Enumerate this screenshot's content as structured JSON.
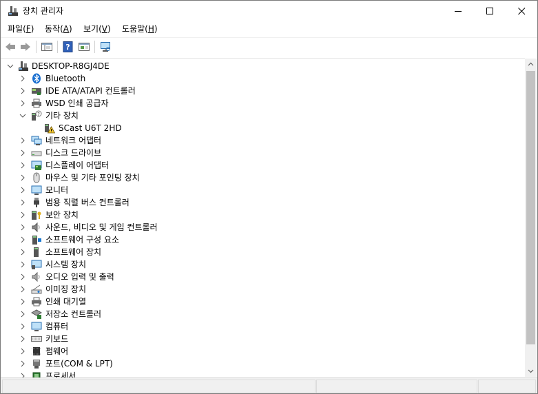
{
  "window": {
    "title": "장치 관리자",
    "buttons": {
      "minimize": "minimize",
      "maximize": "maximize",
      "close": "close"
    }
  },
  "menu": [
    {
      "label": "파일",
      "accel": "F"
    },
    {
      "label": "동작",
      "accel": "A"
    },
    {
      "label": "보기",
      "accel": "V"
    },
    {
      "label": "도움말",
      "accel": "H"
    }
  ],
  "toolbar": {
    "icons": [
      "back-arrow-icon",
      "forward-arrow-icon",
      "properties-pane-icon",
      "help-icon",
      "details-view-icon",
      "monitor-scan-icon"
    ]
  },
  "tree": {
    "root": "DESKTOP-R8GJ4DE",
    "items": [
      {
        "label": "Bluetooth",
        "icon": "bluetooth-icon",
        "expanded": false
      },
      {
        "label": "IDE ATA/ATAPI 컨트롤러",
        "icon": "ide-controller-icon",
        "expanded": false
      },
      {
        "label": "WSD 인쇄 공급자",
        "icon": "printer-icon",
        "expanded": false
      },
      {
        "label": "기타 장치",
        "icon": "unknown-device-icon",
        "expanded": true,
        "children": [
          {
            "label": "SCast U6T 2HD",
            "icon": "warning-device-icon"
          }
        ]
      },
      {
        "label": "네트워크 어댑터",
        "icon": "network-icon",
        "expanded": false
      },
      {
        "label": "디스크 드라이브",
        "icon": "disk-drive-icon",
        "expanded": false
      },
      {
        "label": "디스플레이 어댑터",
        "icon": "display-adapter-icon",
        "expanded": false
      },
      {
        "label": "마우스 및 기타 포인팅 장치",
        "icon": "mouse-icon",
        "expanded": false
      },
      {
        "label": "모니터",
        "icon": "monitor-icon",
        "expanded": false
      },
      {
        "label": "범용 직렬 버스 컨트롤러",
        "icon": "usb-icon",
        "expanded": false
      },
      {
        "label": "보안 장치",
        "icon": "security-device-icon",
        "expanded": false
      },
      {
        "label": "사운드, 비디오 및 게임 컨트롤러",
        "icon": "sound-icon",
        "expanded": false
      },
      {
        "label": "소프트웨어 구성 요소",
        "icon": "software-component-icon",
        "expanded": false
      },
      {
        "label": "소프트웨어 장치",
        "icon": "software-device-icon",
        "expanded": false
      },
      {
        "label": "시스템 장치",
        "icon": "system-device-icon",
        "expanded": false
      },
      {
        "label": "오디오 입력 및 출력",
        "icon": "audio-io-icon",
        "expanded": false
      },
      {
        "label": "이미징 장치",
        "icon": "imaging-icon",
        "expanded": false
      },
      {
        "label": "인쇄 대기열",
        "icon": "print-queue-icon",
        "expanded": false
      },
      {
        "label": "저장소 컨트롤러",
        "icon": "storage-controller-icon",
        "expanded": false
      },
      {
        "label": "컴퓨터",
        "icon": "computer-icon",
        "expanded": false
      },
      {
        "label": "키보드",
        "icon": "keyboard-icon",
        "expanded": false
      },
      {
        "label": "펌웨어",
        "icon": "firmware-icon",
        "expanded": false
      },
      {
        "label": "포트(COM & LPT)",
        "icon": "port-icon",
        "expanded": false
      },
      {
        "label": "프로세서",
        "icon": "processor-icon",
        "expanded": false
      }
    ]
  },
  "colors": {
    "accent": "#0078d7",
    "scroll_thumb": "#c2c2c2",
    "chrome": "#f0f0f0"
  }
}
